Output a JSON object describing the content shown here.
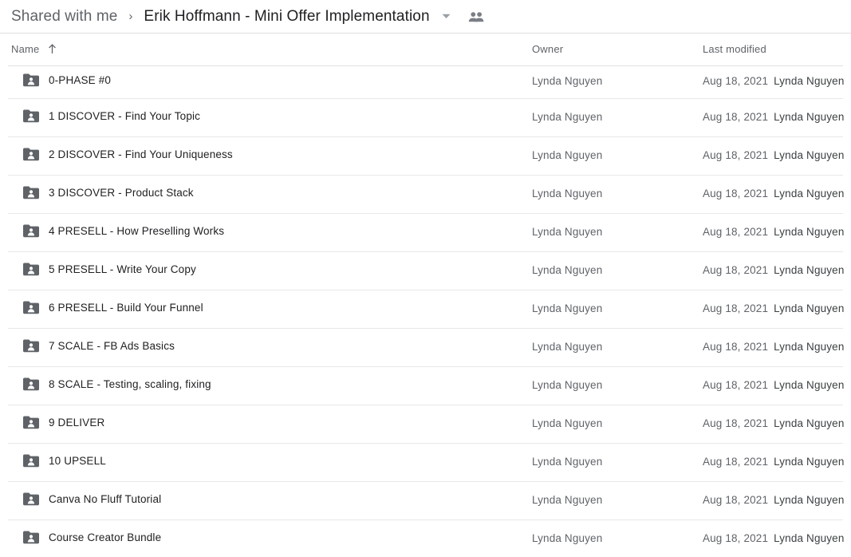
{
  "breadcrumb": {
    "parent": "Shared with me",
    "separator": "›",
    "current": "Erik Hoffmann - Mini Offer Implementation",
    "caret_icon": "chevron-down-icon",
    "people_icon": "people-icon"
  },
  "columns": {
    "name": "Name",
    "sort_arrow": "arrow-up-icon",
    "owner": "Owner",
    "modified": "Last modified"
  },
  "colors": {
    "folder_icon": "#5f6368",
    "primary_text": "#202124",
    "secondary_text": "#5f6368",
    "divider": "#e0e0e0"
  },
  "rows": [
    {
      "name": "0-PHASE #0",
      "owner": "Lynda Nguyen",
      "date": "Aug 18, 2021",
      "modified_by": "Lynda Nguyen",
      "icon": "shared-folder-icon"
    },
    {
      "name": "1 DISCOVER - Find Your Topic",
      "owner": "Lynda Nguyen",
      "date": "Aug 18, 2021",
      "modified_by": "Lynda Nguyen",
      "icon": "shared-folder-icon"
    },
    {
      "name": "2 DISCOVER - Find Your Uniqueness",
      "owner": "Lynda Nguyen",
      "date": "Aug 18, 2021",
      "modified_by": "Lynda Nguyen",
      "icon": "shared-folder-icon"
    },
    {
      "name": "3 DISCOVER - Product Stack",
      "owner": "Lynda Nguyen",
      "date": "Aug 18, 2021",
      "modified_by": "Lynda Nguyen",
      "icon": "shared-folder-icon"
    },
    {
      "name": "4 PRESELL - How Preselling Works",
      "owner": "Lynda Nguyen",
      "date": "Aug 18, 2021",
      "modified_by": "Lynda Nguyen",
      "icon": "shared-folder-icon"
    },
    {
      "name": "5 PRESELL - Write Your Copy",
      "owner": "Lynda Nguyen",
      "date": "Aug 18, 2021",
      "modified_by": "Lynda Nguyen",
      "icon": "shared-folder-icon"
    },
    {
      "name": "6 PRESELL - Build Your Funnel",
      "owner": "Lynda Nguyen",
      "date": "Aug 18, 2021",
      "modified_by": "Lynda Nguyen",
      "icon": "shared-folder-icon"
    },
    {
      "name": "7 SCALE - FB Ads Basics",
      "owner": "Lynda Nguyen",
      "date": "Aug 18, 2021",
      "modified_by": "Lynda Nguyen",
      "icon": "shared-folder-icon"
    },
    {
      "name": "8 SCALE - Testing, scaling, fixing",
      "owner": "Lynda Nguyen",
      "date": "Aug 18, 2021",
      "modified_by": "Lynda Nguyen",
      "icon": "shared-folder-icon"
    },
    {
      "name": "9 DELIVER",
      "owner": "Lynda Nguyen",
      "date": "Aug 18, 2021",
      "modified_by": "Lynda Nguyen",
      "icon": "shared-folder-icon"
    },
    {
      "name": "10 UPSELL",
      "owner": "Lynda Nguyen",
      "date": "Aug 18, 2021",
      "modified_by": "Lynda Nguyen",
      "icon": "shared-folder-icon"
    },
    {
      "name": "Canva No Fluff Tutorial",
      "owner": "Lynda Nguyen",
      "date": "Aug 18, 2021",
      "modified_by": "Lynda Nguyen",
      "icon": "shared-folder-icon"
    },
    {
      "name": "Course Creator Bundle",
      "owner": "Lynda Nguyen",
      "date": "Aug 18, 2021",
      "modified_by": "Lynda Nguyen",
      "icon": "shared-folder-icon"
    }
  ]
}
